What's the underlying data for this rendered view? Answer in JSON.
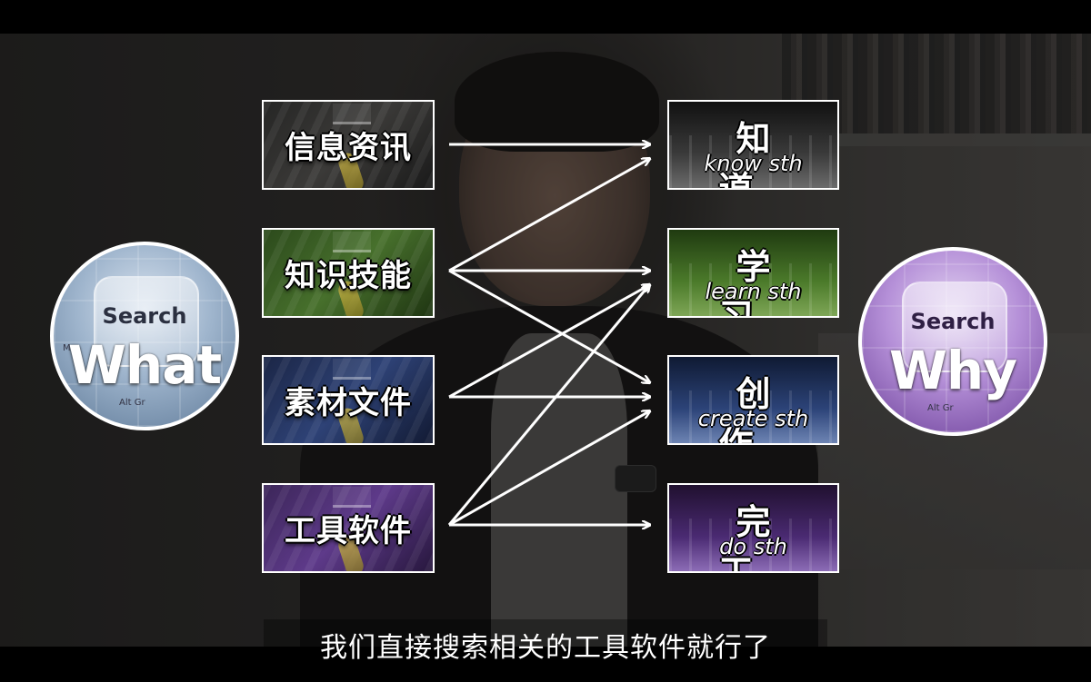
{
  "video": {
    "subtitle": "我们直接搜索相关的工具软件就行了"
  },
  "badges": {
    "what": {
      "search_label": "Search",
      "main_word": "What",
      "small_key_1": "M",
      "small_key_2": "Alt Gr",
      "color": "#7f9ab8"
    },
    "why": {
      "search_label": "Search",
      "main_word": "Why",
      "small_key_1": "Alt Gr",
      "color": "#9a6fc6"
    }
  },
  "categories": [
    {
      "label": "信息资讯",
      "color": "#2e2e2d"
    },
    {
      "label": "知识技能",
      "color": "#47702c"
    },
    {
      "label": "素材文件",
      "color": "#2e4276"
    },
    {
      "label": "工具软件",
      "color": "#5e3a8a"
    }
  ],
  "goals": [
    {
      "cn": "知道",
      "en": "know sth",
      "color": "#3a3a3a"
    },
    {
      "cn": "学习",
      "en": "learn sth",
      "color": "#4b7a2a"
    },
    {
      "cn": "创作",
      "en": "create sth",
      "color": "#2c4378"
    },
    {
      "cn": "完工",
      "en": "do sth",
      "color": "#4a2a72"
    }
  ],
  "mappings": [
    {
      "from": "信息资讯",
      "to": "知道"
    },
    {
      "from": "知识技能",
      "to": "知道"
    },
    {
      "from": "知识技能",
      "to": "学习"
    },
    {
      "from": "知识技能",
      "to": "创作"
    },
    {
      "from": "素材文件",
      "to": "学习"
    },
    {
      "from": "素材文件",
      "to": "创作"
    },
    {
      "from": "工具软件",
      "to": "学习"
    },
    {
      "from": "工具软件",
      "to": "创作"
    },
    {
      "from": "工具软件",
      "to": "完工"
    }
  ]
}
